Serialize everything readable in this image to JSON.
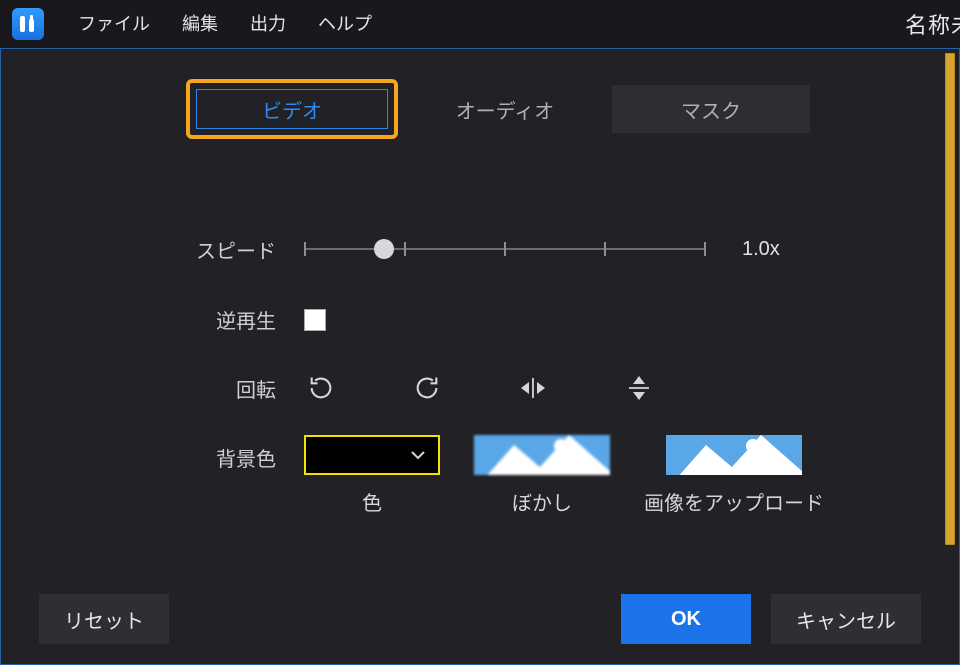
{
  "menubar": {
    "items": [
      "ファイル",
      "編集",
      "出力",
      "ヘルプ"
    ],
    "right_title": "名称未"
  },
  "tabs": {
    "video": "ビデオ",
    "audio": "オーディオ",
    "mask": "マスク",
    "active": "video"
  },
  "controls": {
    "speed": {
      "label": "スピード",
      "value_text": "1.0x",
      "value_fraction": 0.2,
      "ticks": 5
    },
    "reverse": {
      "label": "逆再生",
      "checked": false
    },
    "rotate": {
      "label": "回転",
      "buttons": [
        "rotate-ccw",
        "rotate-cw",
        "flip-horizontal",
        "flip-vertical"
      ]
    },
    "background": {
      "label": "背景色",
      "options": {
        "color": {
          "label": "色",
          "selected_hex": "#000000",
          "highlighted": true
        },
        "blur": {
          "label": "ぼかし"
        },
        "upload": {
          "label": "画像をアップロード"
        }
      }
    }
  },
  "footer": {
    "reset": "リセット",
    "ok": "OK",
    "cancel": "キャンセル"
  },
  "colors": {
    "accent_blue": "#1a73e8",
    "highlight_orange": "#f6a623",
    "highlight_yellow": "#f2e200"
  }
}
